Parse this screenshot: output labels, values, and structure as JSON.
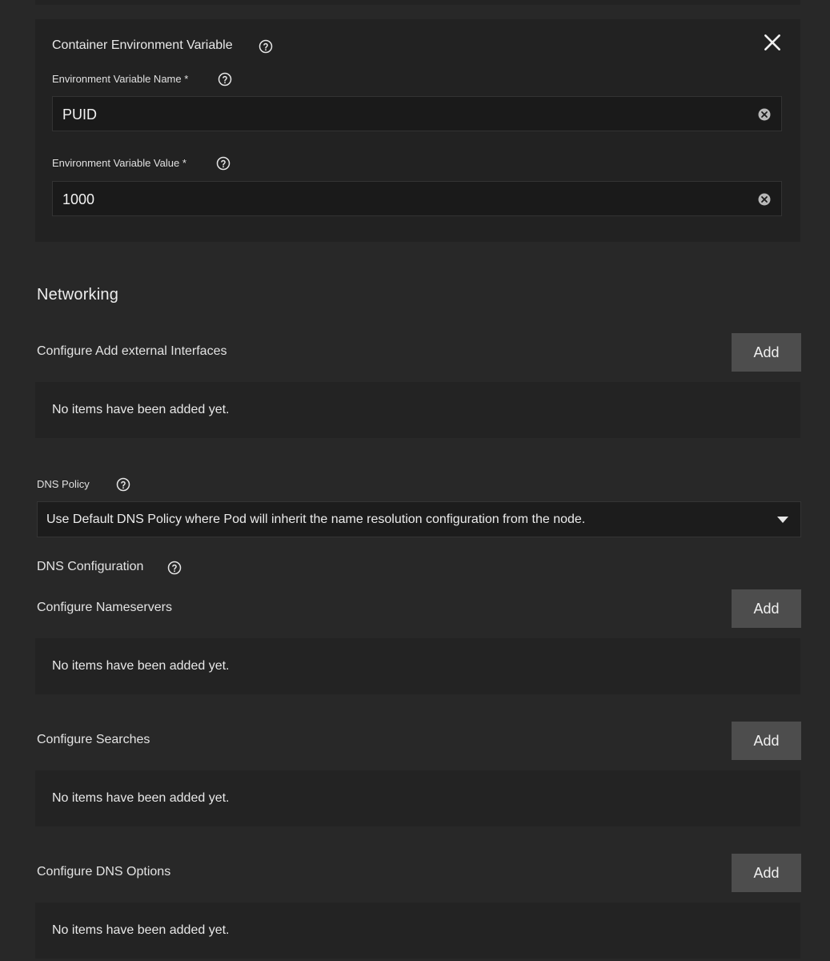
{
  "env_var": {
    "title": "Container Environment Variable",
    "name_label": "Environment Variable Name *",
    "name_value": "PUID",
    "value_label": "Environment Variable Value *",
    "value_value": "1000"
  },
  "networking": {
    "title": "Networking",
    "external_interfaces": {
      "label": "Configure Add external Interfaces",
      "add_label": "Add",
      "empty_text": "No items have been added yet."
    },
    "dns_policy": {
      "label": "DNS Policy",
      "selected": "Use Default DNS Policy where Pod will inherit the name resolution configuration from the node."
    },
    "dns_configuration": {
      "label": "DNS Configuration",
      "nameservers": {
        "label": "Configure Nameservers",
        "add_label": "Add",
        "empty_text": "No items have been added yet."
      },
      "searches": {
        "label": "Configure Searches",
        "add_label": "Add",
        "empty_text": "No items have been added yet."
      },
      "options": {
        "label": "Configure DNS Options",
        "add_label": "Add",
        "empty_text": "No items have been added yet."
      }
    }
  },
  "icons": {
    "help": "help-circle-icon",
    "close": "close-icon",
    "clear": "clear-circle-icon",
    "dropdown": "chevron-down-icon"
  },
  "colors": {
    "background": "#282828",
    "card": "#222222",
    "input": "#1a1a1a",
    "button": "#4d4d4d",
    "text": "#e6e6e6"
  }
}
